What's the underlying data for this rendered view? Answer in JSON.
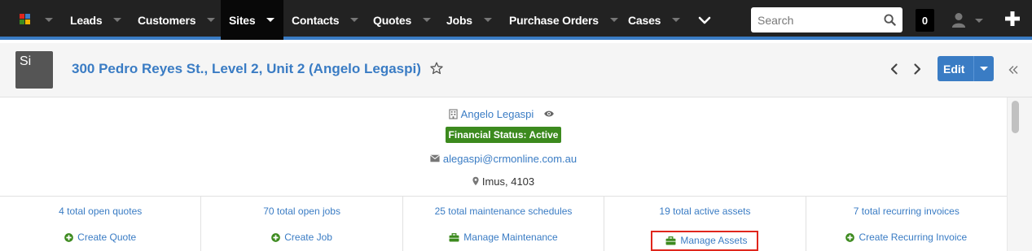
{
  "navbar": {
    "items": [
      {
        "label": "Leads"
      },
      {
        "label": "Customers"
      },
      {
        "label": "Sites",
        "active": true
      },
      {
        "label": "Contacts"
      },
      {
        "label": "Quotes"
      },
      {
        "label": "Jobs"
      },
      {
        "label": "Purchase Orders"
      },
      {
        "label": "Cases"
      }
    ],
    "search_placeholder": "Search",
    "notification_count": "0",
    "accent_color": "#3a7cc4"
  },
  "header": {
    "avatar_text": "Si",
    "title": "300 Pedro Reyes St., Level 2, Unit 2 (Angelo Legaspi)",
    "edit_label": "Edit"
  },
  "info": {
    "customer_name": "Angelo Legaspi",
    "financial_status": "Financial Status: Active",
    "email": "alegaspi@crmonline.com.au",
    "location": "Imus, 4103"
  },
  "stats": [
    {
      "summary": "4 total open quotes",
      "action": "Create Quote",
      "action_icon": "plus-circle-icon"
    },
    {
      "summary": "70 total open jobs",
      "action": "Create Job",
      "action_icon": "plus-circle-icon"
    },
    {
      "summary": "25 total maintenance schedules",
      "action": "Manage Maintenance",
      "action_icon": "briefcase-icon"
    },
    {
      "summary": "19 total active assets",
      "action": "Manage Assets",
      "action_icon": "briefcase-icon",
      "highlighted": true
    },
    {
      "summary": "7 total recurring invoices",
      "action": "Create Recurring Invoice",
      "action_icon": "plus-circle-icon"
    }
  ],
  "colors": {
    "link": "#3a7cc4",
    "status_green": "#3c8a1e",
    "action_icon_green": "#3c8a1e",
    "highlight_red": "#e0261c",
    "navbar_bg": "#222222"
  }
}
